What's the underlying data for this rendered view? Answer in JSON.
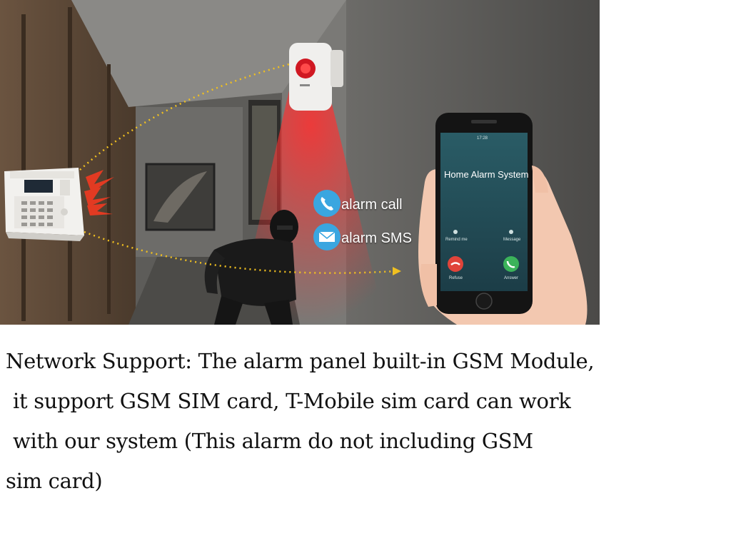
{
  "scene": {
    "call_label": "alarm call",
    "sms_label": "alarm SMS",
    "phone": {
      "app_title": "Home Alarm System",
      "remind_label": "Remind me",
      "message_label": "Message",
      "refuse_label": "Refuse",
      "answer_label": "Answer",
      "status_time": "17:28"
    },
    "colors": {
      "call_bubble": "#3aa6e0",
      "refuse": "#e0443a",
      "answer": "#3bb35a",
      "sensor_light": "#e0202a",
      "signal_arrow": "#f0c020"
    }
  },
  "caption": {
    "line1": "Network Support: The alarm panel built-in GSM Module,",
    "line2": "it support GSM SIM card, T-Mobile sim card can work",
    "line3": "with our system (This alarm do not including GSM",
    "line4": "sim card)"
  }
}
